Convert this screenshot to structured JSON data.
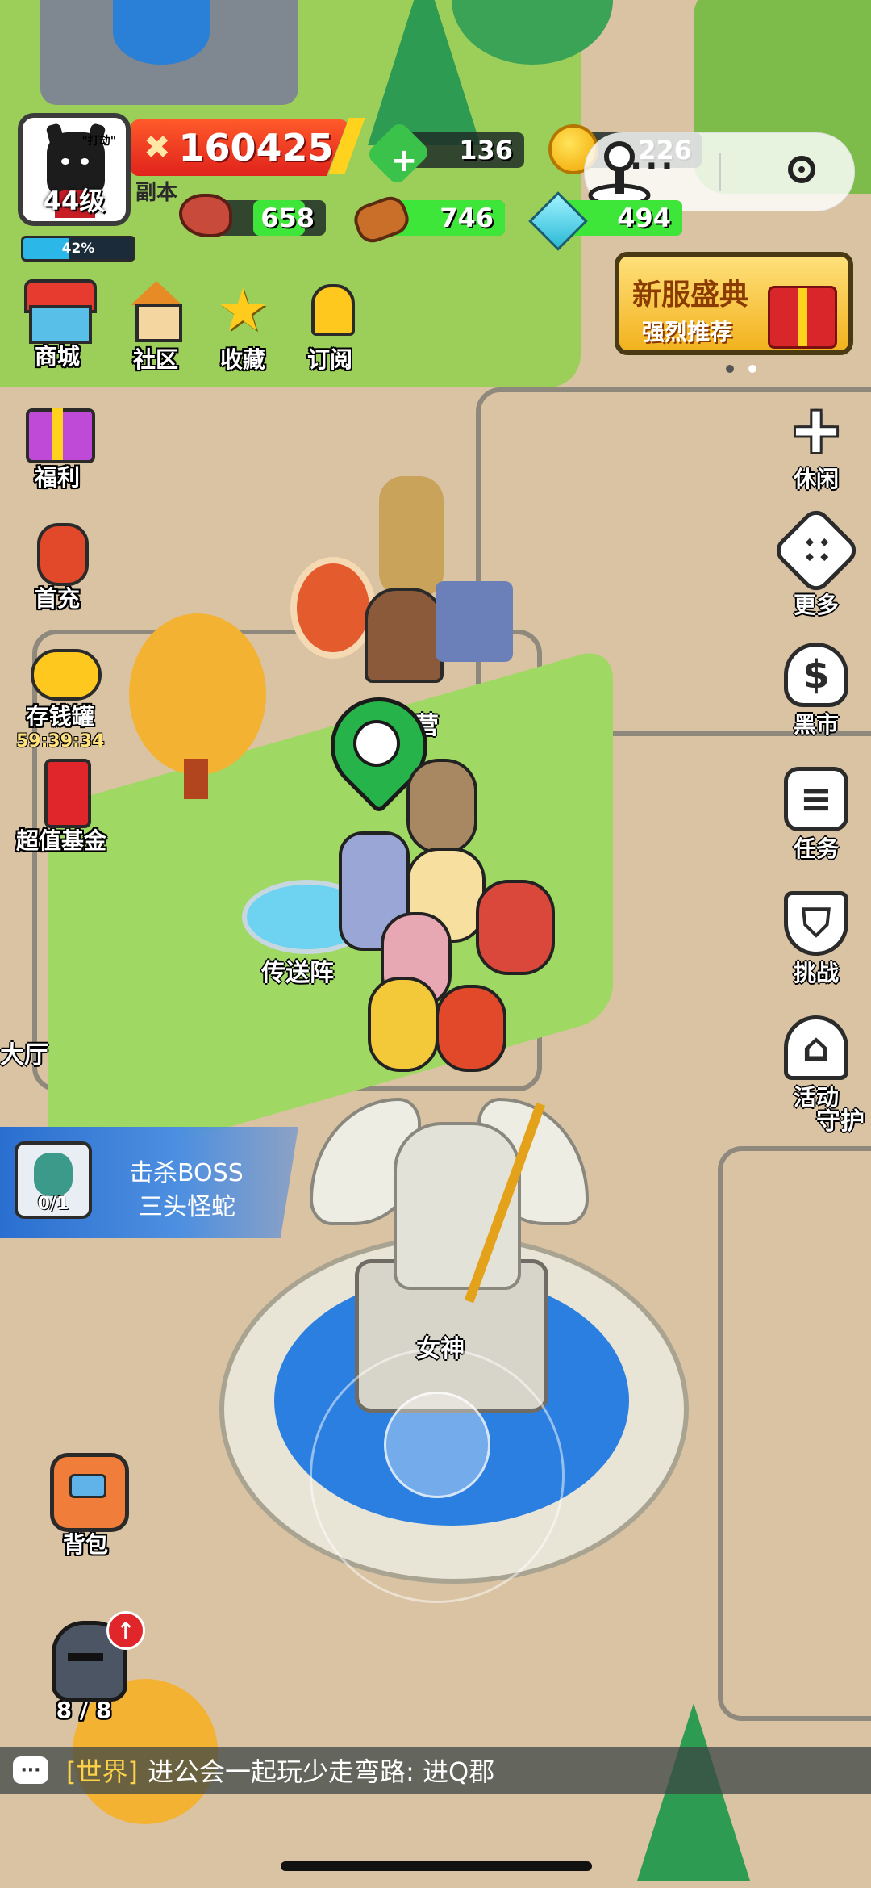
{
  "player": {
    "level": "44级",
    "xp_percent_label": "42%",
    "xp_percent": 42,
    "avatar_tag": "\"打劫\""
  },
  "power": {
    "value": "160425",
    "sub_label": "副本"
  },
  "resources": {
    "gems": "136",
    "coins": "226",
    "meat": "658",
    "wood": "746",
    "crystal": "494"
  },
  "miniprogram": {
    "menu_label": "···"
  },
  "banner": {
    "title": "新服盛典",
    "subtitle": "强烈推荐"
  },
  "top_menu": [
    {
      "label": "商城"
    },
    {
      "label": "社区"
    },
    {
      "label": "收藏"
    },
    {
      "label": "订阅"
    }
  ],
  "left_menu": [
    {
      "label": "福利"
    },
    {
      "label": "首充"
    },
    {
      "label": "存钱罐",
      "sub": "59:39:34"
    },
    {
      "label": "超值基金"
    }
  ],
  "right_menu": [
    {
      "label": "休闲",
      "icon": "plus-icon"
    },
    {
      "label": "更多",
      "icon": "dice-icon"
    },
    {
      "label": "黑市",
      "icon": "money-bag-icon"
    },
    {
      "label": "任务",
      "icon": "list-icon"
    },
    {
      "label": "挑战",
      "icon": "shield-icon"
    },
    {
      "label": "活动",
      "icon": "bell-icon"
    }
  ],
  "map_labels": {
    "camp": "营",
    "portal": "传送阵",
    "hall": "大厅",
    "guard": "守护",
    "goddess": "女神"
  },
  "quest": {
    "progress": "0/1",
    "line1": "击杀BOSS",
    "line2": "三头怪蛇"
  },
  "bag": {
    "label": "背包"
  },
  "hero": {
    "count": "8 / 8"
  },
  "chat": {
    "channel": "[世界]",
    "message": "进公会一起玩少走弯路: 进Q郡"
  },
  "colors": {
    "power": "#e0221c",
    "resource_fill": "#3ee63a",
    "xp": "#2bb7e8",
    "quest": "#2a6fd0"
  }
}
